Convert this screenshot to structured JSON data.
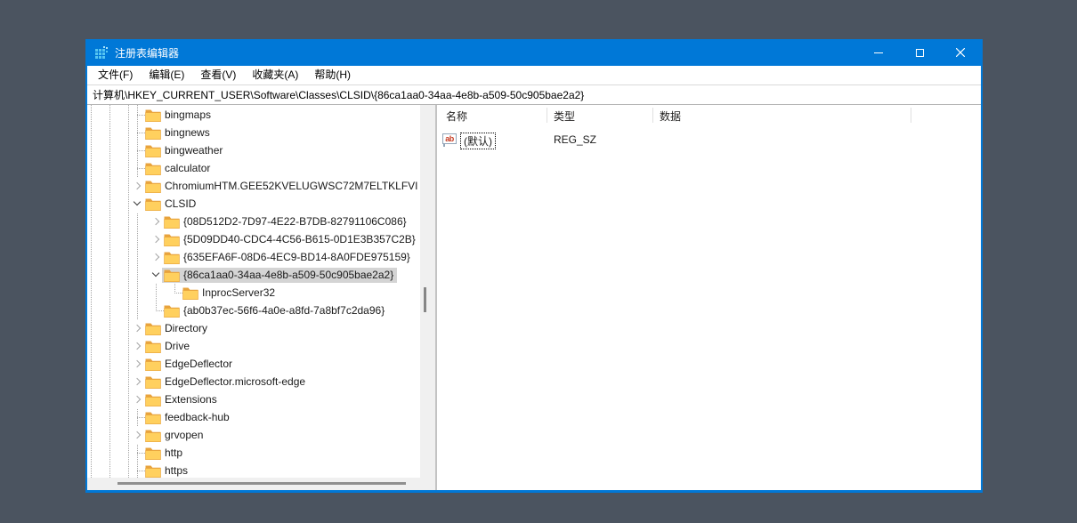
{
  "window": {
    "title": "注册表编辑器",
    "controls": [
      {
        "id": "minimize",
        "icon": "minimize-icon"
      },
      {
        "id": "maximize",
        "icon": "maximize-icon"
      },
      {
        "id": "close",
        "icon": "close-icon"
      }
    ]
  },
  "menu": {
    "items": [
      {
        "id": "file",
        "label": "文件(F)"
      },
      {
        "id": "edit",
        "label": "编辑(E)"
      },
      {
        "id": "view",
        "label": "查看(V)"
      },
      {
        "id": "favorites",
        "label": "收藏夹(A)"
      },
      {
        "id": "help",
        "label": "帮助(H)"
      }
    ]
  },
  "address": {
    "value": "计算机\\HKEY_CURRENT_USER\\Software\\Classes\\CLSID\\{86ca1aa0-34aa-4e8b-a509-50c905bae2a2}"
  },
  "tree": {
    "items": [
      {
        "label": "bingmaps",
        "level": 0,
        "state": "leaf",
        "selected": false
      },
      {
        "label": "bingnews",
        "level": 0,
        "state": "leaf",
        "selected": false
      },
      {
        "label": "bingweather",
        "level": 0,
        "state": "leaf",
        "selected": false
      },
      {
        "label": "calculator",
        "level": 0,
        "state": "leaf",
        "selected": false
      },
      {
        "label": "ChromiumHTM.GEE52KVELUGWSC72M7ELTKLFVI",
        "level": 0,
        "state": "collapsed",
        "selected": false
      },
      {
        "label": "CLSID",
        "level": 0,
        "state": "expanded",
        "selected": false
      },
      {
        "label": "{08D512D2-7D97-4E22-B7DB-82791106C086}",
        "level": 1,
        "state": "collapsed",
        "selected": false
      },
      {
        "label": "{5D09DD40-CDC4-4C56-B615-0D1E3B357C2B}",
        "level": 1,
        "state": "collapsed",
        "selected": false
      },
      {
        "label": "{635EFA6F-08D6-4EC9-BD14-8A0FDE975159}",
        "level": 1,
        "state": "collapsed",
        "selected": false
      },
      {
        "label": "{86ca1aa0-34aa-4e8b-a509-50c905bae2a2}",
        "level": 1,
        "state": "expanded",
        "selected": true
      },
      {
        "label": "InprocServer32",
        "level": 2,
        "state": "leaf",
        "selected": false
      },
      {
        "label": "{ab0b37ec-56f6-4a0e-a8fd-7a8bf7c2da96}",
        "level": 1,
        "state": "leaf",
        "selected": false
      },
      {
        "label": "Directory",
        "level": 0,
        "state": "collapsed",
        "selected": false
      },
      {
        "label": "Drive",
        "level": 0,
        "state": "collapsed",
        "selected": false
      },
      {
        "label": "EdgeDeflector",
        "level": 0,
        "state": "collapsed",
        "selected": false
      },
      {
        "label": "EdgeDeflector.microsoft-edge",
        "level": 0,
        "state": "collapsed",
        "selected": false
      },
      {
        "label": "Extensions",
        "level": 0,
        "state": "collapsed",
        "selected": false
      },
      {
        "label": "feedback-hub",
        "level": 0,
        "state": "leaf",
        "selected": false
      },
      {
        "label": "grvopen",
        "level": 0,
        "state": "collapsed",
        "selected": false
      },
      {
        "label": "http",
        "level": 0,
        "state": "leaf",
        "selected": false
      },
      {
        "label": "https",
        "level": 0,
        "state": "leaf",
        "selected": false
      }
    ]
  },
  "list": {
    "columns": [
      {
        "id": "name",
        "label": "名称"
      },
      {
        "id": "type",
        "label": "类型"
      },
      {
        "id": "data",
        "label": "数据"
      }
    ],
    "rows": [
      {
        "name": "(默认)",
        "type": "REG_SZ",
        "data": "",
        "icon": "reg-sz-icon",
        "icon_text": "ab",
        "focused": true
      }
    ]
  },
  "colors": {
    "accent": "#0078d7",
    "desktop_background": "#4b5460",
    "selection_inactive": "#d4d4d4",
    "folder_body": "#ffd05e",
    "folder_tab": "#e8a33d",
    "regsz_icon_text": "#c63b22"
  }
}
